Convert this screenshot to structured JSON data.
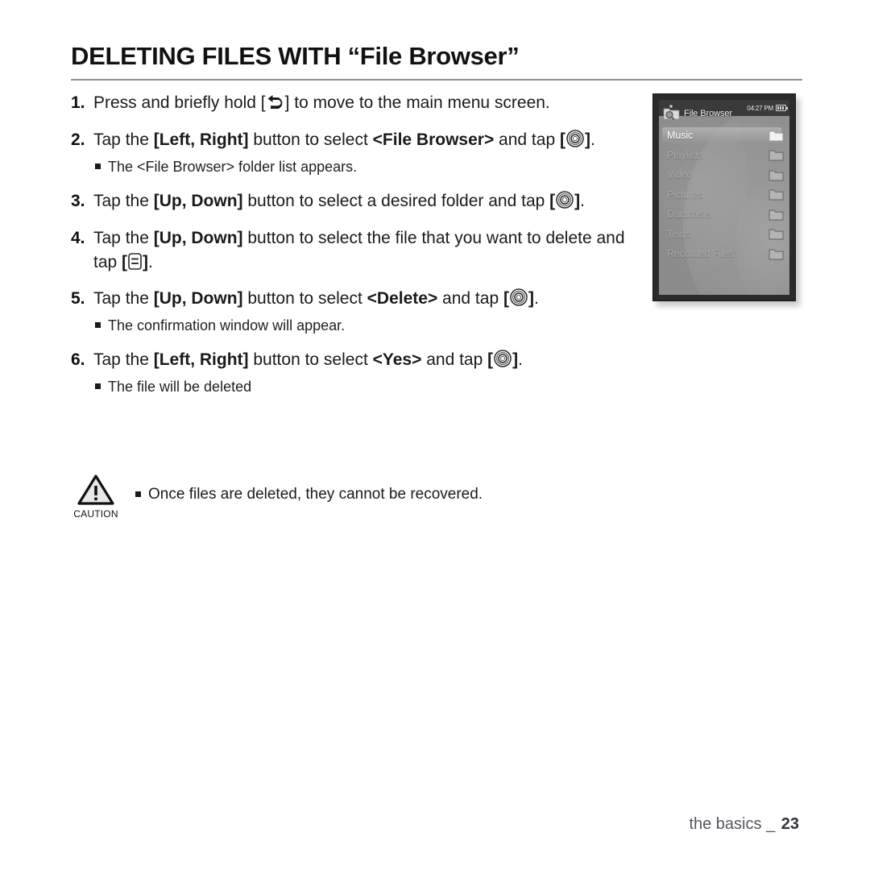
{
  "document": {
    "title": "DELETING FILES WITH “File Browser”",
    "footer_section": "the basics",
    "footer_separator": "_",
    "page_number": "23"
  },
  "icons": {
    "back": "back-arrow-icon",
    "select": "select-circle-icon",
    "menu": "menu-button-icon",
    "caution": "caution-triangle-icon",
    "file_browser": "file-browser-folder-search-icon",
    "folder": "folder-icon",
    "battery": "battery-icon"
  },
  "steps": [
    {
      "number": "1.",
      "parts": [
        {
          "t": "Press and briefly hold [",
          "b": false
        },
        {
          "t": "ICON:back",
          "b": false
        },
        {
          "t": "] to move to the main menu screen.",
          "b": false
        }
      ],
      "notes": []
    },
    {
      "number": "2.",
      "parts": [
        {
          "t": "Tap the ",
          "b": false
        },
        {
          "t": "[Left, Right]",
          "b": true
        },
        {
          "t": " button to select ",
          "b": false
        },
        {
          "t": "<File Browser>",
          "b": true
        },
        {
          "t": " and tap ",
          "b": false
        },
        {
          "t": "[",
          "b": true
        },
        {
          "t": "ICON:select",
          "b": false
        },
        {
          "t": "]",
          "b": true
        },
        {
          "t": ".",
          "b": false
        }
      ],
      "notes": [
        "The <File Browser> folder list appears."
      ]
    },
    {
      "number": "3.",
      "parts": [
        {
          "t": "Tap the ",
          "b": false
        },
        {
          "t": "[Up, Down]",
          "b": true
        },
        {
          "t": " button to select a desired folder and tap ",
          "b": false
        },
        {
          "t": "[",
          "b": true
        },
        {
          "t": "ICON:select",
          "b": false
        },
        {
          "t": "]",
          "b": true
        },
        {
          "t": ".",
          "b": false
        }
      ],
      "notes": []
    },
    {
      "number": "4.",
      "parts": [
        {
          "t": "Tap the ",
          "b": false
        },
        {
          "t": "[Up, Down]",
          "b": true
        },
        {
          "t": " button to select the file that you want to delete and tap ",
          "b": false
        },
        {
          "t": "[",
          "b": true
        },
        {
          "t": "ICON:menu",
          "b": false
        },
        {
          "t": "]",
          "b": true
        },
        {
          "t": ".",
          "b": false
        }
      ],
      "notes": []
    },
    {
      "number": "5.",
      "parts": [
        {
          "t": "Tap the ",
          "b": false
        },
        {
          "t": "[Up, Down]",
          "b": true
        },
        {
          "t": " button to select ",
          "b": false
        },
        {
          "t": "<Delete>",
          "b": true
        },
        {
          "t": " and tap ",
          "b": false
        },
        {
          "t": "[",
          "b": true
        },
        {
          "t": "ICON:select",
          "b": false
        },
        {
          "t": "]",
          "b": true
        },
        {
          "t": ".",
          "b": false
        }
      ],
      "notes": [
        "The confirmation window will appear."
      ]
    },
    {
      "number": "6.",
      "parts": [
        {
          "t": " Tap the ",
          "b": false
        },
        {
          "t": "[Left, Right]",
          "b": true
        },
        {
          "t": " button to select ",
          "b": false
        },
        {
          "t": "<Yes>",
          "b": true
        },
        {
          "t": " and tap ",
          "b": false
        },
        {
          "t": "[",
          "b": true
        },
        {
          "t": "ICON:select",
          "b": false
        },
        {
          "t": "]",
          "b": true
        },
        {
          "t": ".",
          "b": false
        }
      ],
      "notes": [
        "The file will be deleted"
      ]
    }
  ],
  "caution": {
    "label": "CAUTION",
    "text": "Once files are deleted, they cannot be recovered."
  },
  "device": {
    "status": {
      "time": "04:27 PM"
    },
    "screen_title": "File Browser",
    "menu_items": [
      {
        "label": "Music",
        "selected": true
      },
      {
        "label": "Playlists",
        "selected": false
      },
      {
        "label": "Video",
        "selected": false
      },
      {
        "label": "Pictures",
        "selected": false
      },
      {
        "label": "Datacasts",
        "selected": false
      },
      {
        "label": "Texts",
        "selected": false
      },
      {
        "label": "Recorded Files",
        "selected": false
      }
    ]
  },
  "colors": {
    "title_rule": "#8d8d8d",
    "screen_bg": "#8b8b8b",
    "bezel": "#2b2b2b",
    "footer_text": "#55555f",
    "selected_text": "#ffffff",
    "unselected_text": "#a8a8a8"
  }
}
